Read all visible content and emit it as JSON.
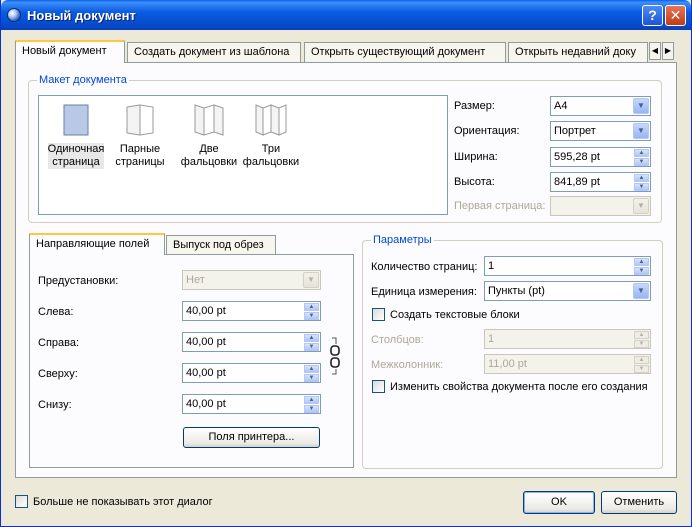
{
  "window": {
    "title": "Новый документ",
    "help_label": "?",
    "close_label": "✕"
  },
  "tabs": [
    {
      "label": "Новый документ",
      "active": true
    },
    {
      "label": "Создать документ из шаблона"
    },
    {
      "label": "Открыть существующий документ"
    },
    {
      "label": "Открыть недавний доку"
    }
  ],
  "layout": {
    "group_label": "Макет документа",
    "items": [
      {
        "label_line1": "Одиночная",
        "label_line2": "страница",
        "icon": "single-page-icon",
        "selected": true
      },
      {
        "label_line1": "Парные",
        "label_line2": "страницы",
        "icon": "facing-pages-icon"
      },
      {
        "label_line1": "Две",
        "label_line2": "фальцовки",
        "icon": "two-folds-icon"
      },
      {
        "label_line1": "Три",
        "label_line2": "фальцовки",
        "icon": "three-folds-icon"
      }
    ],
    "size_label": "Размер:",
    "size_value": "A4",
    "orientation_label": "Ориентация:",
    "orientation_value": "Портрет",
    "width_label": "Ширина:",
    "width_value": "595,28 pt",
    "height_label": "Высота:",
    "height_value": "841,89 pt",
    "first_page_label": "Первая страница:",
    "first_page_value": ""
  },
  "margins": {
    "tab_guides": "Направляющие полей",
    "tab_bleed": "Выпуск под обрез",
    "preset_label": "Предустановки:",
    "preset_value": "Нет",
    "left_label": "Слева:",
    "left_value": "40,00 pt",
    "right_label": "Справа:",
    "right_value": "40,00 pt",
    "top_label": "Сверху:",
    "top_value": "40,00 pt",
    "bottom_label": "Снизу:",
    "bottom_value": "40,00 pt",
    "printer_button": "Поля принтера..."
  },
  "params": {
    "group_label": "Параметры",
    "pages_label": "Количество страниц:",
    "pages_value": "1",
    "unit_label": "Единица измерения:",
    "unit_value": "Пункты (pt)",
    "text_frames_label": "Создать текстовые блоки",
    "columns_label": "Столбцов:",
    "columns_value": "1",
    "gap_label": "Межколонник:",
    "gap_value": "11,00 pt",
    "change_props_label": "Изменить свойства документа после его создания"
  },
  "footer": {
    "dont_show_label": "Больше не показывать этот диалог",
    "ok_label": "OK",
    "cancel_label": "Отменить"
  }
}
